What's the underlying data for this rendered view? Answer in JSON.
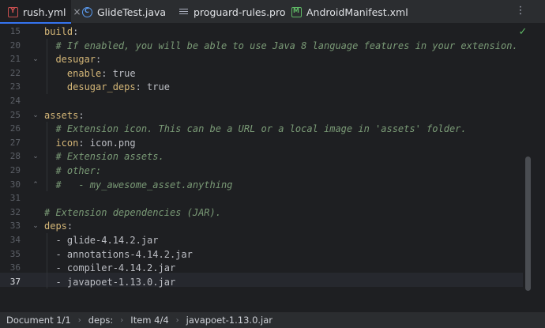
{
  "tabs": [
    {
      "label": "rush.yml",
      "icon": "yaml-file-icon",
      "active": true
    },
    {
      "label": "GlideTest.java",
      "icon": "java-class-icon"
    },
    {
      "label": "proguard-rules.pro",
      "icon": "text-file-icon"
    },
    {
      "label": "AndroidManifest.xml",
      "icon": "manifest-icon"
    }
  ],
  "close_glyph": "×",
  "menu_glyph": "⋮",
  "check_glyph": "✓",
  "gutter": [
    "15",
    "20",
    "21",
    "22",
    "23",
    "24",
    "25",
    "26",
    "27",
    "28",
    "29",
    "30",
    "31",
    "32",
    "33",
    "34",
    "35",
    "36",
    "37"
  ],
  "code": [
    {
      "indent": "",
      "parts": [
        [
          "k",
          "build"
        ],
        [
          "v",
          ":"
        ]
      ]
    },
    {
      "indent": "  ",
      "parts": [
        [
          "c",
          "# If enabled, you will be able to use Java 8 language features in your extension."
        ]
      ]
    },
    {
      "indent": "  ",
      "parts": [
        [
          "k",
          "desugar"
        ],
        [
          "v",
          ":"
        ]
      ]
    },
    {
      "indent": "    ",
      "parts": [
        [
          "k",
          "enable"
        ],
        [
          "v",
          ": true"
        ]
      ]
    },
    {
      "indent": "    ",
      "parts": [
        [
          "k",
          "desugar_deps"
        ],
        [
          "v",
          ": true"
        ]
      ]
    },
    {
      "indent": "",
      "parts": []
    },
    {
      "indent": "",
      "parts": [
        [
          "k",
          "assets"
        ],
        [
          "v",
          ":"
        ]
      ]
    },
    {
      "indent": "  ",
      "parts": [
        [
          "c",
          "# Extension icon. This can be a URL or a local image in 'assets' folder."
        ]
      ]
    },
    {
      "indent": "  ",
      "parts": [
        [
          "k",
          "icon"
        ],
        [
          "v",
          ": icon.png"
        ]
      ]
    },
    {
      "indent": "  ",
      "parts": [
        [
          "c",
          "# Extension assets."
        ]
      ]
    },
    {
      "indent": "  ",
      "parts": [
        [
          "c",
          "# other:"
        ]
      ]
    },
    {
      "indent": "  ",
      "parts": [
        [
          "c",
          "#   - my_awesome_asset.anything"
        ]
      ]
    },
    {
      "indent": "",
      "parts": []
    },
    {
      "indent": "",
      "parts": [
        [
          "c",
          "# Extension dependencies (JAR)."
        ]
      ]
    },
    {
      "indent": "",
      "parts": [
        [
          "k",
          "deps"
        ],
        [
          "v",
          ":"
        ]
      ]
    },
    {
      "indent": "  ",
      "parts": [
        [
          "v",
          "- glide-4.14.2.jar"
        ]
      ]
    },
    {
      "indent": "  ",
      "parts": [
        [
          "v",
          "- annotations-4.14.2.jar"
        ]
      ]
    },
    {
      "indent": "  ",
      "parts": [
        [
          "v",
          "- compiler-4.14.2.jar"
        ]
      ]
    },
    {
      "indent": "  ",
      "parts": [
        [
          "v",
          "- javapoet-1.13.0.jar"
        ]
      ]
    }
  ],
  "status": {
    "crumbs": [
      "Document 1/1",
      "deps:",
      "Item 4/4",
      "javapoet-1.13.0.jar"
    ],
    "sep_glyph": "›"
  }
}
